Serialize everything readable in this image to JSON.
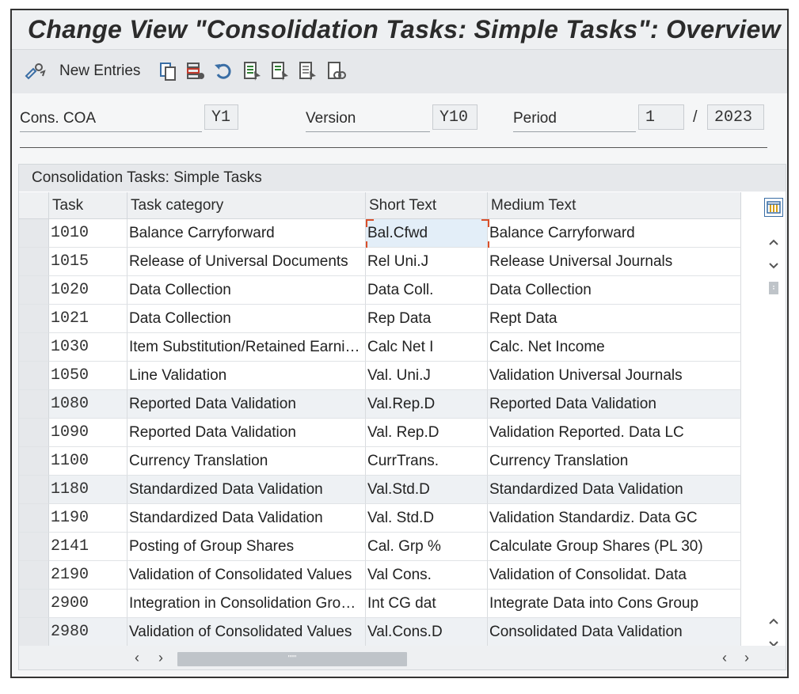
{
  "window": {
    "title": "Change View \"Consolidation Tasks: Simple Tasks\": Overview"
  },
  "toolbar": {
    "new_entries_label": "New Entries",
    "icons": [
      "display-change-icon",
      "copy-as-icon",
      "delete-icon",
      "undo-icon",
      "select-all-icon",
      "select-block-icon",
      "deselect-all-icon",
      "choose-icon"
    ]
  },
  "header": {
    "coa_label": "Cons. COA",
    "coa_value": "Y1",
    "version_label": "Version",
    "version_value": "Y10",
    "period_label": "Period",
    "period_value": "1",
    "period_sep": "/",
    "year_value": "2023"
  },
  "table": {
    "title": "Consolidation Tasks: Simple Tasks",
    "columns": [
      "Task",
      "Task category",
      "Short Text",
      "Medium Text"
    ],
    "rows": [
      {
        "task": "1010",
        "category": "Balance Carryforward",
        "short": "Bal.Cfwd",
        "medium": "Balance Carryforward"
      },
      {
        "task": "1015",
        "category": "Release of Universal Documents",
        "short": "Rel Uni.J",
        "medium": "Release Universal Journals"
      },
      {
        "task": "1020",
        "category": "Data Collection",
        "short": "Data Coll.",
        "medium": "Data Collection"
      },
      {
        "task": "1021",
        "category": "Data Collection",
        "short": "Rep Data",
        "medium": "Rept Data"
      },
      {
        "task": "1030",
        "category": "Item Substitution/Retained Earni…",
        "short": "Calc Net I",
        "medium": "Calc. Net Income"
      },
      {
        "task": "1050",
        "category": "Line Validation",
        "short": "Val. Uni.J",
        "medium": "Validation Universal Journals"
      },
      {
        "task": "1080",
        "category": "Reported Data Validation",
        "short": "Val.Rep.D",
        "medium": "Reported Data Validation"
      },
      {
        "task": "1090",
        "category": "Reported Data Validation",
        "short": "Val. Rep.D",
        "medium": "Validation Reported. Data LC"
      },
      {
        "task": "1100",
        "category": "Currency Translation",
        "short": "CurrTrans.",
        "medium": "Currency Translation"
      },
      {
        "task": "1180",
        "category": "Standardized Data Validation",
        "short": "Val.Std.D",
        "medium": "Standardized Data Validation"
      },
      {
        "task": "1190",
        "category": "Standardized Data Validation",
        "short": "Val. Std.D",
        "medium": "Validation Standardiz. Data GC"
      },
      {
        "task": "2141",
        "category": "Posting of Group Shares",
        "short": "Cal. Grp %",
        "medium": "Calculate Group Shares (PL 30)"
      },
      {
        "task": "2190",
        "category": "Validation of Consolidated Values",
        "short": "Val Cons.",
        "medium": "Validation of Consolidat. Data"
      },
      {
        "task": "2900",
        "category": "Integration in Consolidation Gro…",
        "short": "Int CG dat",
        "medium": "Integrate Data into Cons Group"
      },
      {
        "task": "2980",
        "category": "Validation of Consolidated Values",
        "short": "Val.Cons.D",
        "medium": "Consolidated Data Validation"
      }
    ]
  },
  "scroll": {
    "thumb_label": "\"\"\""
  }
}
